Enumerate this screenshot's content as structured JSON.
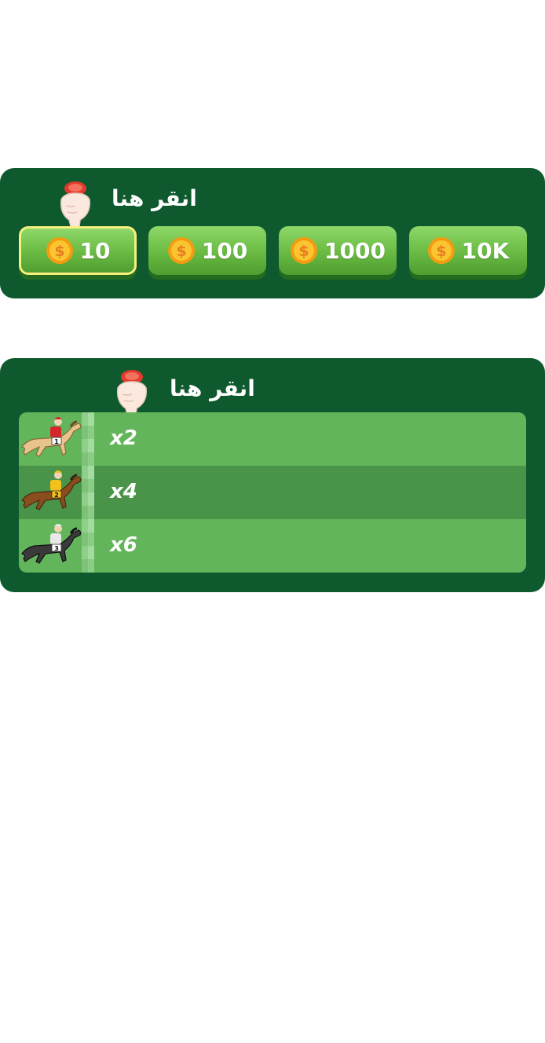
{
  "bet_panel": {
    "hint_text": "انقر هنا",
    "chips": [
      {
        "label": "10",
        "selected": true
      },
      {
        "label": "100",
        "selected": false
      },
      {
        "label": "1000",
        "selected": false
      },
      {
        "label": "10K",
        "selected": false
      }
    ]
  },
  "race_panel": {
    "hint_text": "انقر هنا",
    "lanes": [
      {
        "multiplier": "x2",
        "horse_number": "1",
        "horse_color": "#e8c38a",
        "jockey_color": "#d7262b"
      },
      {
        "multiplier": "x4",
        "horse_number": "2",
        "horse_color": "#8a4e1e",
        "jockey_color": "#f2c21a"
      },
      {
        "multiplier": "x6",
        "horse_number": "3",
        "horse_color": "#3a3a3a",
        "jockey_color": "#e9e9e9"
      }
    ]
  },
  "colors": {
    "panel_bg": "#0e5a2e",
    "button_green": "#6cbd45",
    "selected_border": "#f7ef7e",
    "lane_light": "#62b55a",
    "lane_dark": "#4a944a"
  }
}
